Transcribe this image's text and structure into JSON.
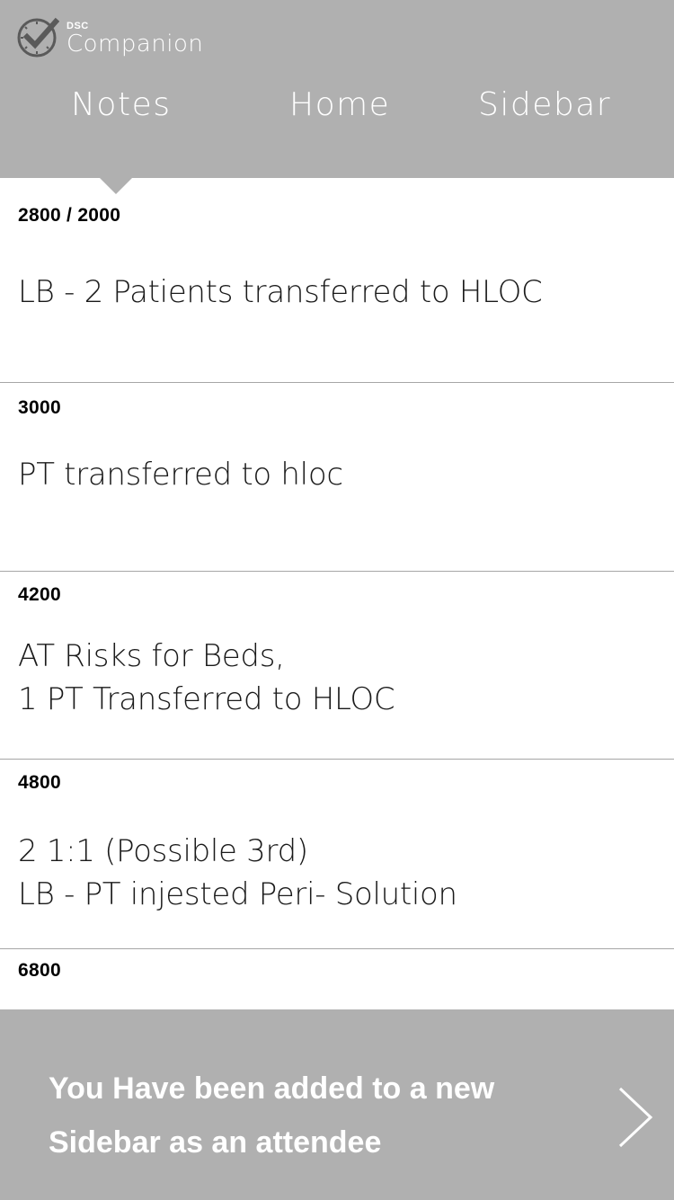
{
  "header": {
    "logo_small": "DSC",
    "logo_name": "Companion",
    "tabs": [
      {
        "label": "Notes",
        "selected": true
      },
      {
        "label": "Home",
        "selected": false
      },
      {
        "label": "Sidebar",
        "selected": false
      }
    ]
  },
  "notes": [
    {
      "label": "2800 / 2000",
      "body": "LB - 2 Patients transferred to HLOC"
    },
    {
      "label": "3000",
      "body": "PT transferred to hloc"
    },
    {
      "label": "4200",
      "body": "AT Risks for Beds,\n1 PT Transferred to HLOC"
    },
    {
      "label": "4800",
      "body": "2 1:1 (Possible 3rd)\nLB - PT injested Peri- Solution"
    },
    {
      "label": "6800",
      "body": ""
    }
  ],
  "toast": {
    "message": "You Have been added to a new\nSidebar as an attendee",
    "icon": "chevron-right-icon"
  },
  "colors": {
    "header_bg": "#b0b0b0",
    "toast_bg": "#b0b0b0",
    "divider": "#a6a6a6",
    "text": "#1a1a1a"
  }
}
